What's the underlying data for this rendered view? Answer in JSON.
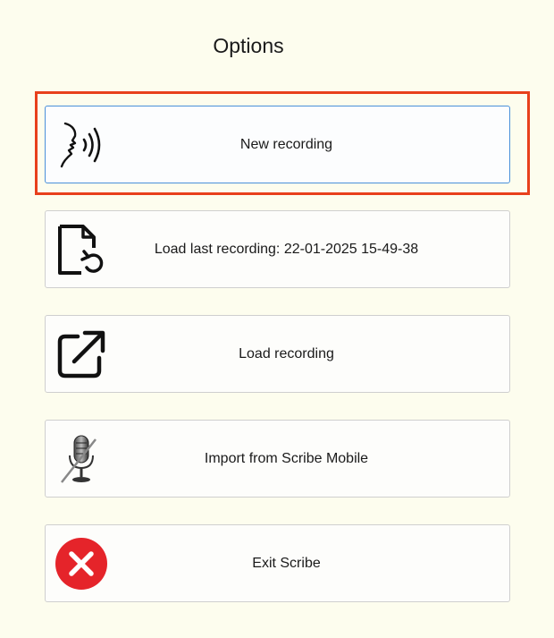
{
  "dialog": {
    "title": "Options"
  },
  "options": [
    {
      "id": "new-recording",
      "label": "New recording",
      "icon": "speaking-head-icon"
    },
    {
      "id": "load-last-recording",
      "label": "Load last recording: 22-01-2025 15-49-38",
      "icon": "file-restore-icon"
    },
    {
      "id": "load-recording",
      "label": "Load recording",
      "icon": "external-open-icon"
    },
    {
      "id": "import-scribe-mobile",
      "label": "Import from Scribe Mobile",
      "icon": "microphone-muted-icon"
    },
    {
      "id": "exit-scribe",
      "label": "Exit Scribe",
      "icon": "close-circle-icon"
    }
  ],
  "colors": {
    "background": "#fdfdee",
    "highlight": "#e8401c",
    "focus_border": "#4a90d9",
    "exit_red": "#e5242a"
  }
}
